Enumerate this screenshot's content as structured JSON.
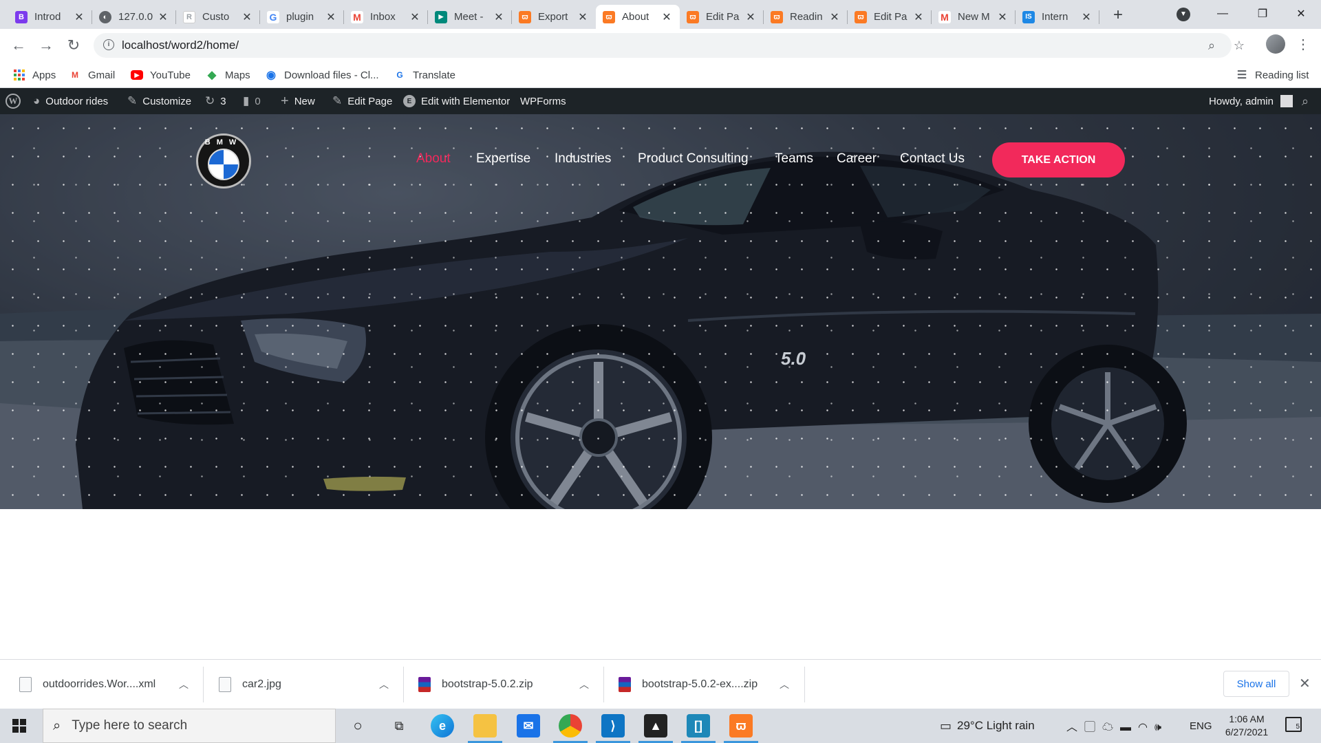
{
  "browser": {
    "tabs": [
      {
        "title": "Introd",
        "favicon": "B",
        "favicon_color": "#7c3aed"
      },
      {
        "title": "127.0.0",
        "favicon": "◐",
        "favicon_color": "#5f6368"
      },
      {
        "title": "Custo",
        "favicon": "R",
        "favicon_color": "#9aa0a6"
      },
      {
        "title": "plugin",
        "favicon": "G",
        "favicon_color": "#4285f4"
      },
      {
        "title": "Inbox",
        "favicon": "M",
        "favicon_color": "#ea4335"
      },
      {
        "title": "Meet -",
        "favicon": "▶",
        "favicon_color": "#00897b"
      },
      {
        "title": "Export",
        "favicon": "ϖ",
        "favicon_color": "#fb7a24"
      },
      {
        "title": "About",
        "favicon": "ϖ",
        "favicon_color": "#fb7a24"
      },
      {
        "title": "Edit Pa",
        "favicon": "ϖ",
        "favicon_color": "#fb7a24"
      },
      {
        "title": "Readin",
        "favicon": "ϖ",
        "favicon_color": "#fb7a24"
      },
      {
        "title": "Edit Pa",
        "favicon": "ϖ",
        "favicon_color": "#fb7a24"
      },
      {
        "title": "New M",
        "favicon": "M",
        "favicon_color": "#ea4335"
      },
      {
        "title": "Intern",
        "favicon": "IS",
        "favicon_color": "#1e88e5"
      }
    ],
    "active_tab_index": 7,
    "url": "localhost/word2/home/",
    "bookmarks": [
      {
        "label": "Apps"
      },
      {
        "label": "Gmail"
      },
      {
        "label": "YouTube"
      },
      {
        "label": "Maps"
      },
      {
        "label": "Download files - Cl..."
      },
      {
        "label": "Translate"
      }
    ],
    "reading_list": "Reading list"
  },
  "admin_bar": {
    "site_name": "Outdoor rides",
    "customize": "Customize",
    "updates_count": "3",
    "comments_count": "0",
    "new": "New",
    "edit_page": "Edit Page",
    "edit_elementor": "Edit with Elementor",
    "wpforms": "WPForms",
    "howdy": "Howdy, admin"
  },
  "site": {
    "logo_text": "BMW",
    "menu": [
      "About",
      "Expertise",
      "Industries",
      "Product Consulting",
      "Teams",
      "Career",
      "Contact Us"
    ],
    "current_menu_index": 0,
    "cta_label": "TAKE ACTION",
    "car_badge": "5.0",
    "accent_color": "#f2295b"
  },
  "downloads": {
    "items": [
      {
        "name": "outdoorrides.Wor....xml",
        "type": "file"
      },
      {
        "name": "car2.jpg",
        "type": "file"
      },
      {
        "name": "bootstrap-5.0.2.zip",
        "type": "zip"
      },
      {
        "name": "bootstrap-5.0.2-ex....zip",
        "type": "zip"
      }
    ],
    "show_all": "Show all"
  },
  "taskbar": {
    "search_placeholder": "Type here to search",
    "weather": "29°C  Light rain",
    "language": "ENG",
    "time": "1:06 AM",
    "date": "6/27/2021",
    "notifications": "5"
  }
}
